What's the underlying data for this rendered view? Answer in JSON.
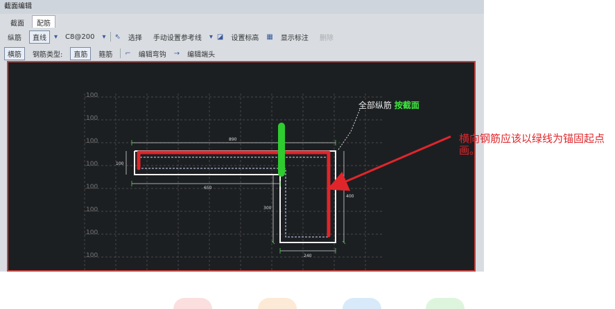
{
  "window": {
    "title": "截面编辑"
  },
  "tabs": [
    {
      "label": "截面"
    },
    {
      "label": "配筋"
    }
  ],
  "toolbar1": {
    "rebar_label": "纵筋",
    "line_button": "直线",
    "spec_value": "C8@200",
    "select_label": "选择",
    "manual_ref_label": "手动设置参考线",
    "set_elev_label": "设置标高",
    "show_dim_label": "显示标注",
    "delete_label": "删除"
  },
  "toolbar2": {
    "transverse_label": "横筋",
    "rebar_type_label": "钢筋类型:",
    "straight_label": "直筋",
    "stirrup_label": "箍筋",
    "edit_hook_label": "编辑弯钩",
    "edit_end_label": "编辑端头"
  },
  "canvas": {
    "axis_labels": [
      "100",
      "100",
      "100",
      "100",
      "100",
      "100",
      "100",
      "100"
    ],
    "annotation_prefix": "全部纵筋",
    "annotation_highlight": "按截面",
    "dims": {
      "top": "890",
      "left": "100",
      "mid": "650",
      "vert_left": "300",
      "vert_right": "400",
      "bottom": "240"
    }
  },
  "note": {
    "text": "横向钢筋应该以绿线为锚固起点画。"
  },
  "colors": {
    "red": "#e0262b",
    "green": "#2ecc2e",
    "canvas_bg": "#1c1f22"
  }
}
